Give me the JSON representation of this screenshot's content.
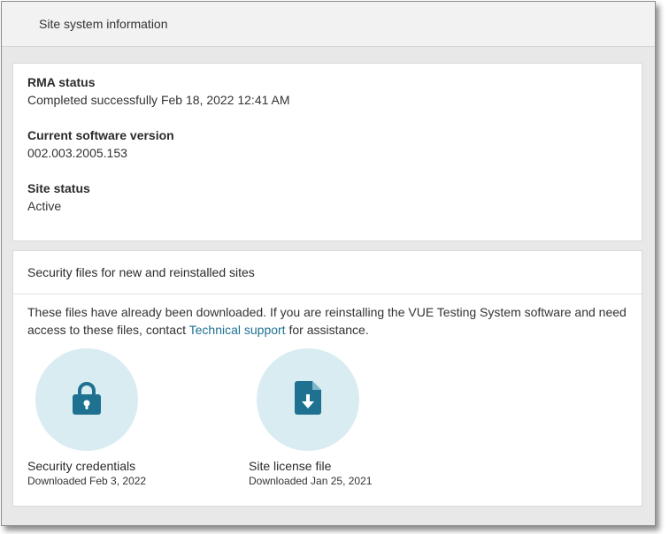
{
  "header": {
    "title": "Site system information"
  },
  "info": {
    "rma_label": "RMA status",
    "rma_value": "Completed successfully Feb 18, 2022 12:41 AM",
    "software_label": "Current software version",
    "software_value": "002.003.2005.153",
    "site_status_label": "Site status",
    "site_status_value": "Active"
  },
  "security": {
    "title": "Security files for new and reinstalled sites",
    "desc_before": "These files have already been downloaded. If you are reinstalling the VUE Testing System software and need access to these files, contact ",
    "link_text": "Technical support",
    "desc_after": " for assistance.",
    "files": [
      {
        "icon": "lock-icon",
        "name": "Security credentials",
        "downloaded": "Downloaded Feb 3, 2022"
      },
      {
        "icon": "file-download-icon",
        "name": "Site license file",
        "downloaded": "Downloaded Jan 25, 2021"
      }
    ]
  },
  "colors": {
    "accent": "#1e7190",
    "icon_circle": "#d9ecf2",
    "background": "#e8e8e8"
  }
}
